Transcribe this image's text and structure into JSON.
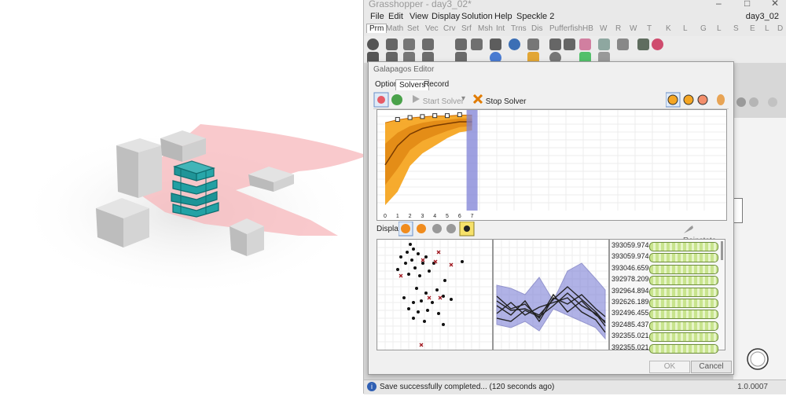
{
  "app": {
    "title": "Grasshopper - day3_02*",
    "doc_name": "day3_02",
    "window_controls": [
      "–",
      "□",
      "✕"
    ]
  },
  "menus": [
    "File",
    "Edit",
    "View",
    "Display",
    "Solution",
    "Help",
    "Speckle 2"
  ],
  "tabs": [
    "Prm",
    "Math",
    "Set",
    "Vec",
    "Crv",
    "Srf",
    "Msh",
    "Int",
    "Trns",
    "Dis",
    "Pufferfish",
    "HB",
    "W",
    "R",
    "W",
    "T",
    "K",
    "L",
    "G",
    "L",
    "S",
    "E",
    "L",
    "D"
  ],
  "active_tab": "Prm",
  "galapagos": {
    "title": "Galapagos Editor",
    "tabs": [
      "Options",
      "Solvers",
      "Record"
    ],
    "active_tab": "Solvers",
    "start_solver": "Start Solver",
    "stop_solver": "Stop Solver",
    "display_label": "Display",
    "reinstate": "Reinstate",
    "x_ticks": [
      "0",
      "1",
      "2",
      "3",
      "4",
      "5",
      "6",
      "7"
    ],
    "fitness_values": [
      "393059.974...",
      "393059.974...",
      "393046.659...",
      "392978.209...",
      "392964.894...",
      "392626.189...",
      "392496.455...",
      "392485.437...",
      "392355.021...",
      "392355.021..."
    ],
    "ok": "OK",
    "cancel": "Cancel"
  },
  "status": {
    "message": "Save successfully completed... (120 seconds ago)",
    "version": "1.0.0007"
  },
  "chart_data": {
    "type": "area",
    "title": "",
    "xlabel": "",
    "ylabel": "",
    "x": [
      0,
      1,
      2,
      3,
      4,
      5,
      6,
      7
    ],
    "series": [
      {
        "values": [
          0.46,
          0.66,
          0.78,
          0.84,
          0.87,
          0.89,
          0.91,
          0.91
        ]
      },
      {
        "values": [
          0.9,
          0.93,
          0.95,
          0.96,
          0.97,
          0.97,
          0.98,
          0.98
        ]
      },
      {
        "values": [
          0.04,
          0.18,
          0.45,
          0.58,
          0.66,
          0.74,
          0.8,
          0.82
        ]
      }
    ],
    "current_generation": 7
  },
  "colors": {
    "accent_blue": "#7d80d6",
    "fitness_orange": "#f5a623",
    "fitness_dark": "#c86a00",
    "button_green": "#9ec853"
  }
}
